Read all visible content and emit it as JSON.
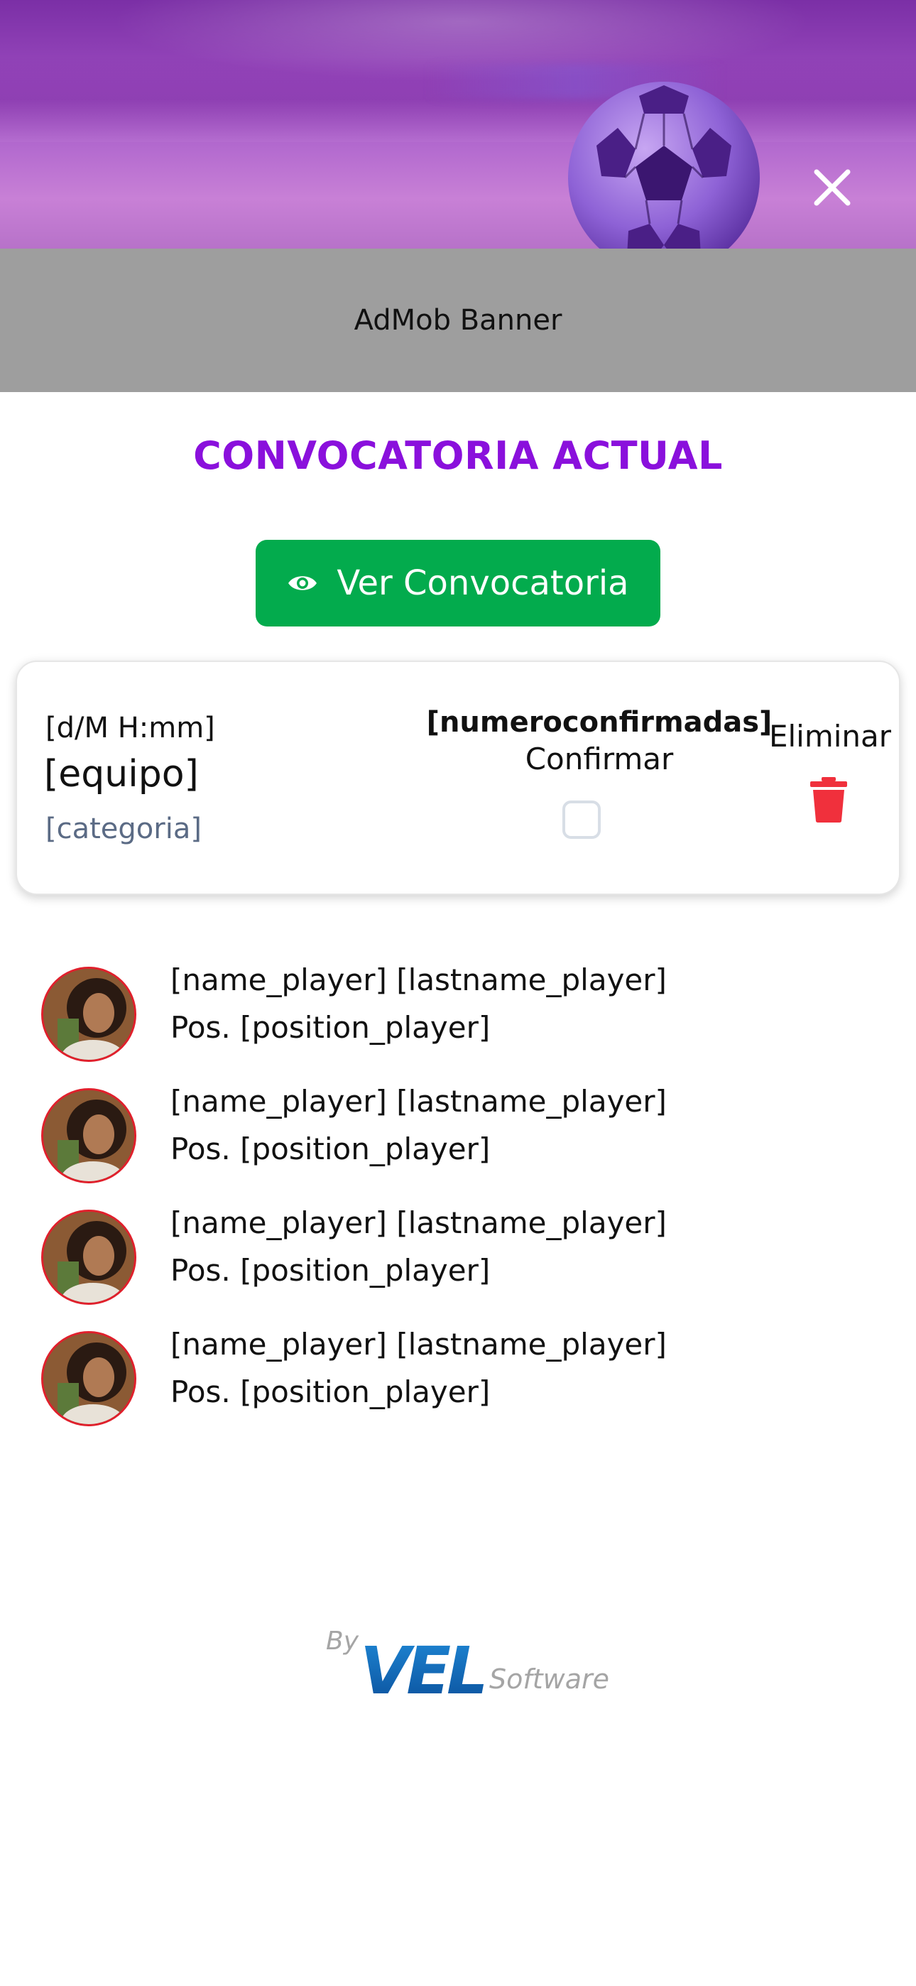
{
  "header": {
    "close_icon": "close-icon",
    "image": "soccer-ball-photo"
  },
  "ad_banner": {
    "label": "AdMob Banner"
  },
  "section": {
    "title": "CONVOCATORIA ACTUAL"
  },
  "view_button": {
    "label": "Ver Convocatoria",
    "icon": "eye-icon",
    "color": "#03ab4d"
  },
  "card": {
    "date": "[d/M H:mm]",
    "team": "[equipo]",
    "category": "[categoria]",
    "confirmed_count": "[numeroconfirmadas]",
    "confirm_label": "Confirmar",
    "confirm_checked": false,
    "delete_label": "Eliminar",
    "delete_icon": "trash-icon"
  },
  "players": [
    {
      "name": "[name_player] [lastname_player]",
      "position": "Pos. [position_player]"
    },
    {
      "name": "[name_player] [lastname_player]",
      "position": "Pos. [position_player]"
    },
    {
      "name": "[name_player] [lastname_player]",
      "position": "Pos. [position_player]"
    },
    {
      "name": "[name_player] [lastname_player]",
      "position": "Pos. [position_player]"
    }
  ],
  "footer": {
    "by": "By",
    "brand": "VEL",
    "suffix": "Software"
  },
  "colors": {
    "accent": "#8a10dc",
    "green": "#03ab4d",
    "danger": "#f0303c",
    "avatar_border": "#e0202c"
  }
}
